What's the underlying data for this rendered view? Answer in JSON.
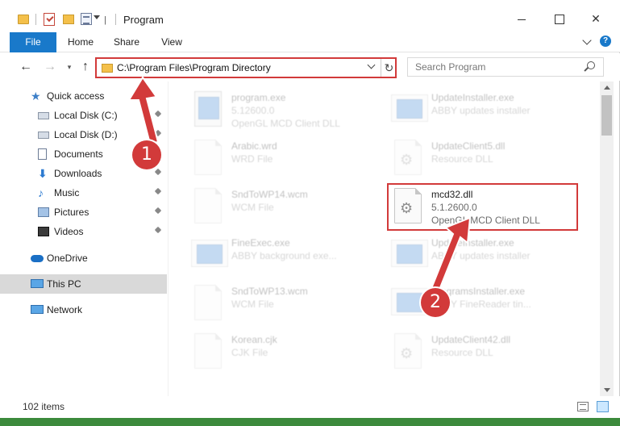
{
  "window": {
    "title": "Program",
    "qa_bar_glyph": "|",
    "minimize_glyph": "",
    "maximize_glyph": "",
    "close_glyph": "✕"
  },
  "ribbon": {
    "tabs": [
      {
        "label": "File"
      },
      {
        "label": "Home"
      },
      {
        "label": "Share"
      },
      {
        "label": "View"
      }
    ],
    "help_glyph": "?"
  },
  "nav": {
    "back_glyph": "←",
    "forward_glyph": "→",
    "recent_glyph": "▾",
    "up_glyph": "↑",
    "address": "C:\\Program Files\\Program Directory",
    "refresh_glyph": "↻",
    "search_placeholder": "Search Program"
  },
  "sidebar": {
    "items": [
      {
        "label": "Quick access",
        "icon": "star-icon"
      },
      {
        "label": "Local Disk (C:)",
        "icon": "disk-icon",
        "pinned": true
      },
      {
        "label": "Local Disk (D:)",
        "icon": "disk-icon",
        "pinned": true
      },
      {
        "label": "Documents",
        "icon": "documents-icon",
        "pinned": true
      },
      {
        "label": "Downloads",
        "icon": "downloads-icon",
        "pinned": true
      },
      {
        "label": "Music",
        "icon": "music-icon",
        "pinned": true
      },
      {
        "label": "Pictures",
        "icon": "pictures-icon",
        "pinned": true
      },
      {
        "label": "Videos",
        "icon": "videos-icon",
        "pinned": true
      },
      {
        "label": "OneDrive",
        "icon": "onedrive-icon"
      },
      {
        "label": "This PC",
        "icon": "pc-icon"
      },
      {
        "label": "Network",
        "icon": "network-icon"
      }
    ]
  },
  "files": [
    {
      "name": "program.exe",
      "line1": "5.12600.0",
      "line2": "OpenGL MCD Client DLL",
      "icon": "exe-icon",
      "faded": true
    },
    {
      "name": "UpdateInstaller.exe",
      "line1": "ABBY updates installer",
      "line2": "",
      "icon": "installer-icon",
      "faded": true
    },
    {
      "name": "Arabic.wrd",
      "line1": "WRD File",
      "line2": "",
      "icon": "blank-file-icon",
      "faded": true
    },
    {
      "name": "UpdateClient5.dll",
      "line1": "Resource DLL",
      "line2": "",
      "icon": "dll-icon",
      "faded": true
    },
    {
      "name": "SndToWP14.wcm",
      "line1": "WCM File",
      "line2": "",
      "icon": "blank-file-icon",
      "faded": true
    },
    {
      "name": "mcd32.dll",
      "line1": "5.1.2600.0",
      "line2": "OpenGL MCD Client DLL",
      "icon": "dll-gear-icon",
      "faded": false
    },
    {
      "name": "FineExec.exe",
      "line1": "ABBY background exe...",
      "line2": "",
      "icon": "installer-icon",
      "faded": true
    },
    {
      "name": "UpdateInstaller.exe",
      "line1": "ABBY updates installer",
      "line2": "",
      "icon": "installer-icon",
      "faded": true
    },
    {
      "name": "SndToWP13.wcm",
      "line1": "WCM File",
      "line2": "",
      "icon": "blank-file-icon",
      "faded": true
    },
    {
      "name": "ProgramsInstaller.exe",
      "line1": "ABBY FineReader tin...",
      "line2": "",
      "icon": "installer-icon",
      "faded": true
    },
    {
      "name": "Korean.cjk",
      "line1": "CJK File",
      "line2": "",
      "icon": "blank-file-icon",
      "faded": true
    },
    {
      "name": "UpdateClient42.dll",
      "line1": "Resource DLL",
      "line2": "",
      "icon": "dll-icon",
      "faded": true
    }
  ],
  "status": {
    "items_count": "102 items"
  },
  "annotations": [
    {
      "number": "1"
    },
    {
      "number": "2"
    }
  ],
  "colors": {
    "accent": "#1979ca",
    "annotation_red": "#d23a3a",
    "selected": "#cce8ff"
  }
}
